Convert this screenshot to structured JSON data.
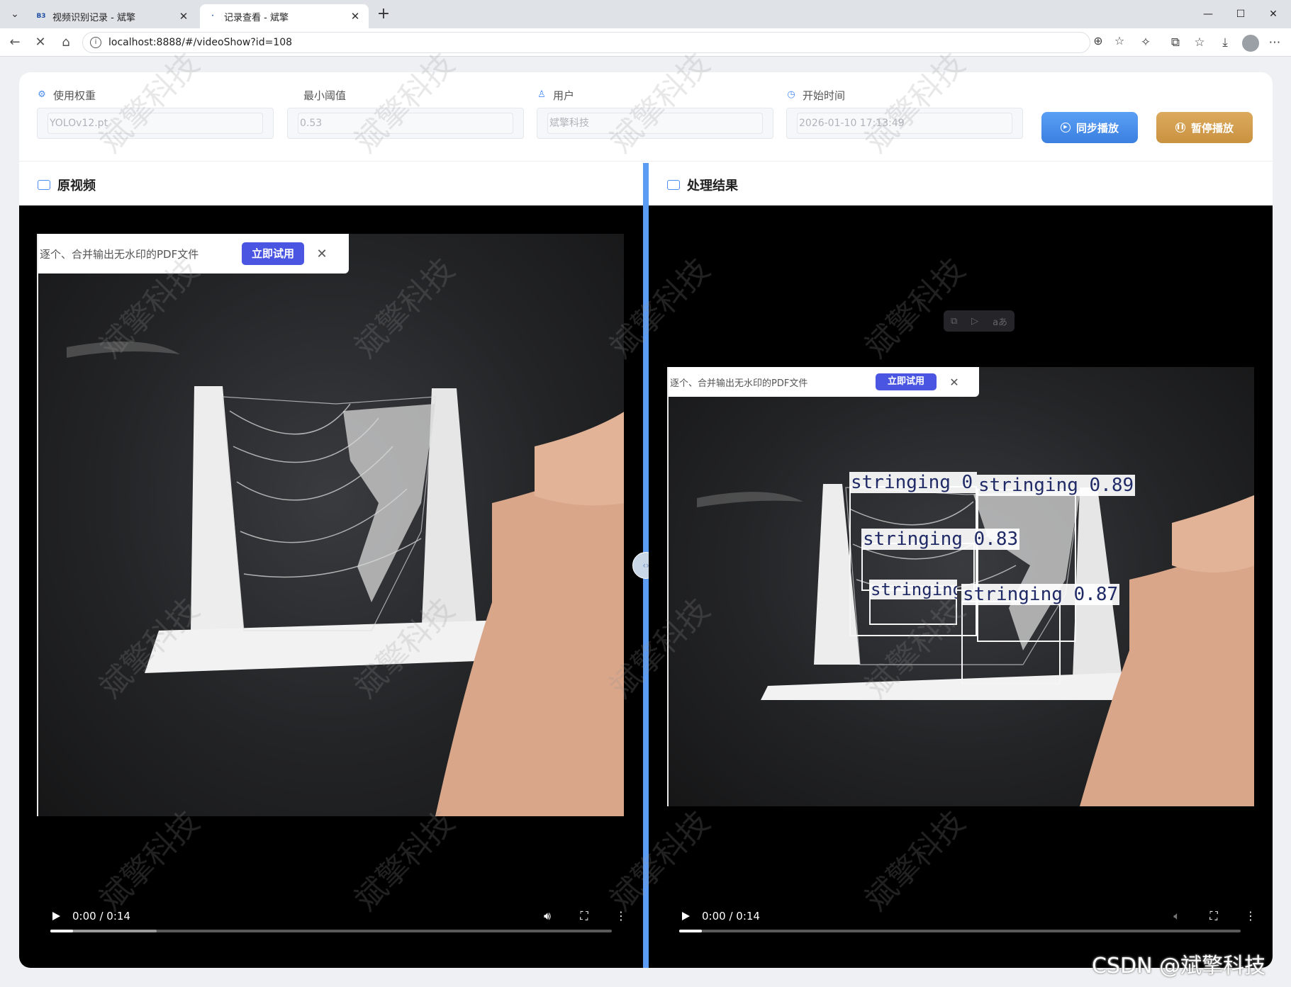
{
  "browser": {
    "tabs": [
      {
        "title": "视频识别记录 - 斌擎",
        "favicon": "B3",
        "active": false
      },
      {
        "title": "记录查看 - 斌擎",
        "favicon": "·",
        "active": true
      }
    ],
    "url": "localhost:8888/#/videoShow?id=108",
    "icons": [
      "back-icon",
      "reload-icon",
      "home-icon",
      "zoom-icon",
      "star-icon",
      "extensions-icon",
      "split-screen-icon",
      "favorites-icon",
      "downloads-icon",
      "profile-icon",
      "more-icon"
    ]
  },
  "filters": {
    "weight": {
      "label": "使用权重",
      "value": "YOLOv12.pt"
    },
    "threshold": {
      "label": "最小阈值",
      "value": "0.53"
    },
    "user": {
      "label": "用户",
      "value": "斌擎科技"
    },
    "start_time": {
      "label": "开始时间",
      "value": "2026-01-10 17:13:49"
    }
  },
  "actions": {
    "sync_play": "同步播放",
    "pause_play": "暂停播放"
  },
  "panels": {
    "original": {
      "title": "原视频"
    },
    "result": {
      "title": "处理结果"
    }
  },
  "ad_overlay": {
    "text": "逐个、合并输出无水印的PDF文件",
    "button": "立即试用",
    "close": "✕"
  },
  "detections": [
    {
      "label": "stringing 0.8",
      "color": "#f5f5f5"
    },
    {
      "label": "stringing 0.89",
      "color": "#f5f5f5"
    },
    {
      "label": "stringing 0.83",
      "color": "#f5f5f5"
    },
    {
      "label": "stringing 0.7",
      "color": "#f5f5f5"
    },
    {
      "label": "stringing 0.87",
      "color": "#f5f5f5"
    }
  ],
  "player": {
    "left": {
      "time": "0:00 / 0:14",
      "progress": 0.04,
      "buffered": 0.19
    },
    "right": {
      "time": "0:00 / 0:14",
      "progress": 0.04,
      "buffered": 0.04
    }
  },
  "watermark_text": "斌擎科技",
  "footer_credit": "CSDN @斌擎科技",
  "colors": {
    "accent": "#4a8df0",
    "sync_button": "#3b7fe0",
    "pause_button": "#c99240",
    "splitter": "#5b9bf3"
  }
}
